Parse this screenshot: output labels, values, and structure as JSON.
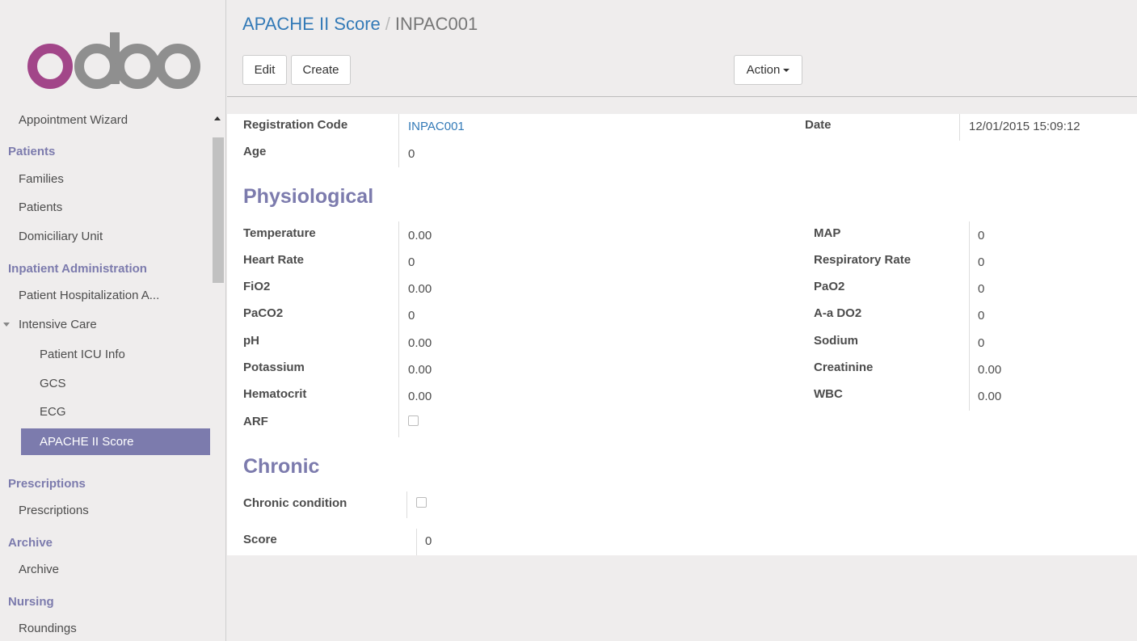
{
  "sidebar": {
    "logo_text": "odoo",
    "items": [
      {
        "label": "Appointment Wizard"
      },
      {
        "label": "Patients"
      },
      {
        "label": "Families"
      },
      {
        "label": "Patients"
      },
      {
        "label": "Domiciliary Unit"
      },
      {
        "label": "Inpatient Administration"
      },
      {
        "label": "Patient Hospitalization A..."
      },
      {
        "label": "Intensive Care"
      },
      {
        "label": "Patient ICU Info"
      },
      {
        "label": "GCS"
      },
      {
        "label": "ECG"
      },
      {
        "label": "APACHE II Score"
      },
      {
        "label": "Prescriptions"
      },
      {
        "label": "Prescriptions"
      },
      {
        "label": "Archive"
      },
      {
        "label": "Archive"
      },
      {
        "label": "Nursing"
      },
      {
        "label": "Roundings"
      }
    ]
  },
  "breadcrumb": {
    "parent": "APACHE II Score",
    "separator": "/",
    "current": "INPAC001"
  },
  "toolbar": {
    "edit": "Edit",
    "create": "Create",
    "action": "Action"
  },
  "form": {
    "registration_code_label": "Registration Code",
    "registration_code_value": "INPAC001",
    "age_label": "Age",
    "age_value": "0",
    "date_label": "Date",
    "date_value": "12/01/2015 15:09:12",
    "physiological_heading": "Physiological",
    "left_fields": [
      {
        "label": "Temperature",
        "value": "0.00"
      },
      {
        "label": "Heart Rate",
        "value": "0"
      },
      {
        "label": "FiO2",
        "value": "0.00"
      },
      {
        "label": "PaCO2",
        "value": "0"
      },
      {
        "label": "pH",
        "value": "0.00"
      },
      {
        "label": "Potassium",
        "value": "0.00"
      },
      {
        "label": "Hematocrit",
        "value": "0.00"
      },
      {
        "label": "ARF",
        "value": ""
      }
    ],
    "right_fields": [
      {
        "label": "MAP",
        "value": "0"
      },
      {
        "label": "Respiratory Rate",
        "value": "0"
      },
      {
        "label": "PaO2",
        "value": "0"
      },
      {
        "label": "A-a DO2",
        "value": "0"
      },
      {
        "label": "Sodium",
        "value": "0"
      },
      {
        "label": "Creatinine",
        "value": "0.00"
      },
      {
        "label": "WBC",
        "value": "0.00"
      }
    ],
    "chronic_heading": "Chronic",
    "chronic_condition_label": "Chronic condition",
    "score_label": "Score",
    "score_value": "0"
  },
  "colors": {
    "accent": "#7c7bad",
    "link": "#337ab7",
    "logo_o": "#a24689",
    "logo_rest": "#8f8f8f"
  }
}
